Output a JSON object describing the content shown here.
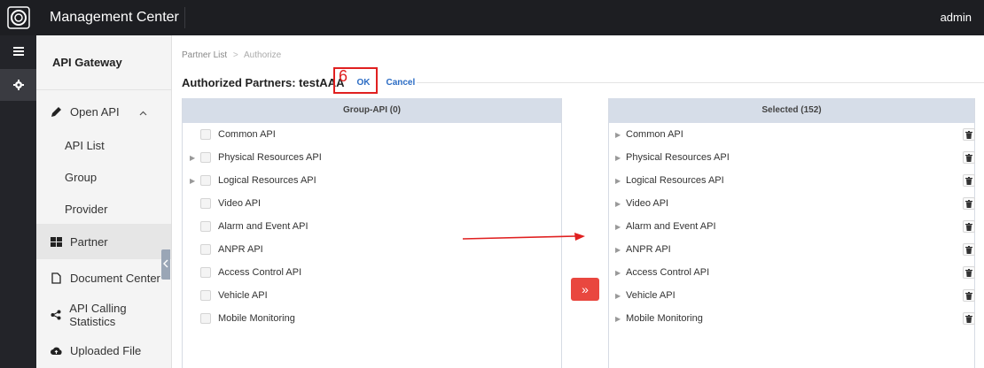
{
  "topbar": {
    "title": "Management Center",
    "user": "admin"
  },
  "iconbar": {
    "items": [
      "menu-icon",
      "gear-icon"
    ]
  },
  "sidebar": {
    "header": "API Gateway",
    "items": [
      {
        "label": "Open API",
        "icon": "pencil-icon"
      },
      {
        "label": "API List"
      },
      {
        "label": "Group"
      },
      {
        "label": "Provider"
      },
      {
        "label": "Partner",
        "icon": "grid-icon"
      },
      {
        "label": "Document Center",
        "icon": "document-icon"
      },
      {
        "label": "API Calling Statistics",
        "icon": "share-icon"
      },
      {
        "label": "Uploaded File",
        "icon": "cloud-upload-icon"
      }
    ]
  },
  "breadcrumb": {
    "parent": "Partner List",
    "separator": ">",
    "current": "Authorize"
  },
  "header": {
    "title": "Authorized Partners: testAAA",
    "ok": "OK",
    "cancel": "Cancel",
    "annotation": "6"
  },
  "left_panel": {
    "title": "Group-API (0)",
    "items": [
      {
        "label": "Common API",
        "expandable": false
      },
      {
        "label": "Physical Resources API",
        "expandable": true
      },
      {
        "label": "Logical Resources API",
        "expandable": true
      },
      {
        "label": "Video API",
        "expandable": false
      },
      {
        "label": "Alarm and Event API",
        "expandable": false
      },
      {
        "label": "ANPR API",
        "expandable": false
      },
      {
        "label": "Access Control API",
        "expandable": false
      },
      {
        "label": "Vehicle API",
        "expandable": false
      },
      {
        "label": "Mobile Monitoring",
        "expandable": false
      }
    ]
  },
  "move_button": {
    "label": "»"
  },
  "right_panel": {
    "title": "Selected (152)",
    "items": [
      "Common API",
      "Physical Resources API",
      "Logical Resources API",
      "Video API",
      "Alarm and Event API",
      "ANPR API",
      "Access Control API",
      "Vehicle API",
      "Mobile Monitoring"
    ]
  },
  "colors": {
    "topbar": "#1d1e22",
    "accent_link": "#2b6cc4",
    "move_button": "#e9473f",
    "annotation": "#e02020",
    "panel_header": "#d6dde8"
  }
}
